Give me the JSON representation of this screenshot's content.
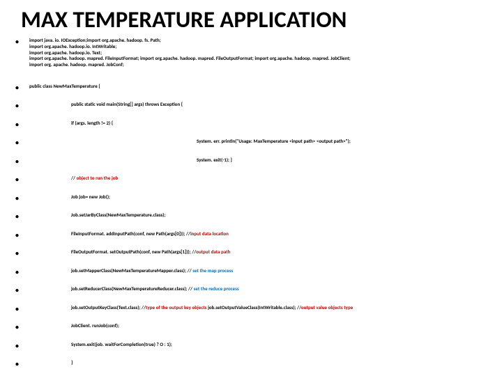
{
  "title": "MAX TEMPERATURE APPLICATION",
  "lines": {
    "l1": "import java. io. IOException;import org.apache. hadoop. fs. Path;\nimport org.apache. hadoop.io. IntWritable;\nimport org.apache. hadoop.io. Text;\nimport org.apache. hadoop. mapred. FileInputFormat; import org.apache. hadoop. mapred. FileOutputFormat; import org.apache. hadoop. mapred. JobClient;\nimport org. apache. hadoop. mapred. JobConf;",
    "l2": "public class NewMaxTemperature {",
    "l3": "public static void main(String[] args) throws  Exception {",
    "l4": "if (args. length != 2) {",
    "l5": "System. err. println(\"Usage: MaxTemperature <input path> <output path>\");",
    "l6": "System. exit(-1); }",
    "l7a": "// ",
    "l7b": "object to run the job",
    "l8": "Job  job= new Job();",
    "l9": "Job.setJarByClass(NewMaxTemperature.class);",
    "l10a": "FileInputFormat. addInputPath(conf, new Path(args[0])); //",
    "l10b": "input data location",
    "l11a": "FileOutputFormat. setOutputPath(conf, new Path(args[1])); //",
    "l11b": "output data path",
    "l12a": "job.setMapperClass(NewMaxTemperatureMapper.class); // ",
    "l12b": "set the map process",
    "l13a": "job.setReducerClass(NewMaxTemperatureReducer.class); // ",
    "l13b": "set the reduce process",
    "l14a": "job.setOutputKeyClass(Text.class); //",
    "l14b": "type of the output key objects ",
    "l14c": "job.setOutputValueClass(IntWritable.class); //",
    "l14d": "output value objects type",
    "l15": "JobClient. runJob(conf); ",
    "l16": "System.exit(job. waitForCompletion(true)  ? O  : 1);",
    "l17": "}"
  }
}
